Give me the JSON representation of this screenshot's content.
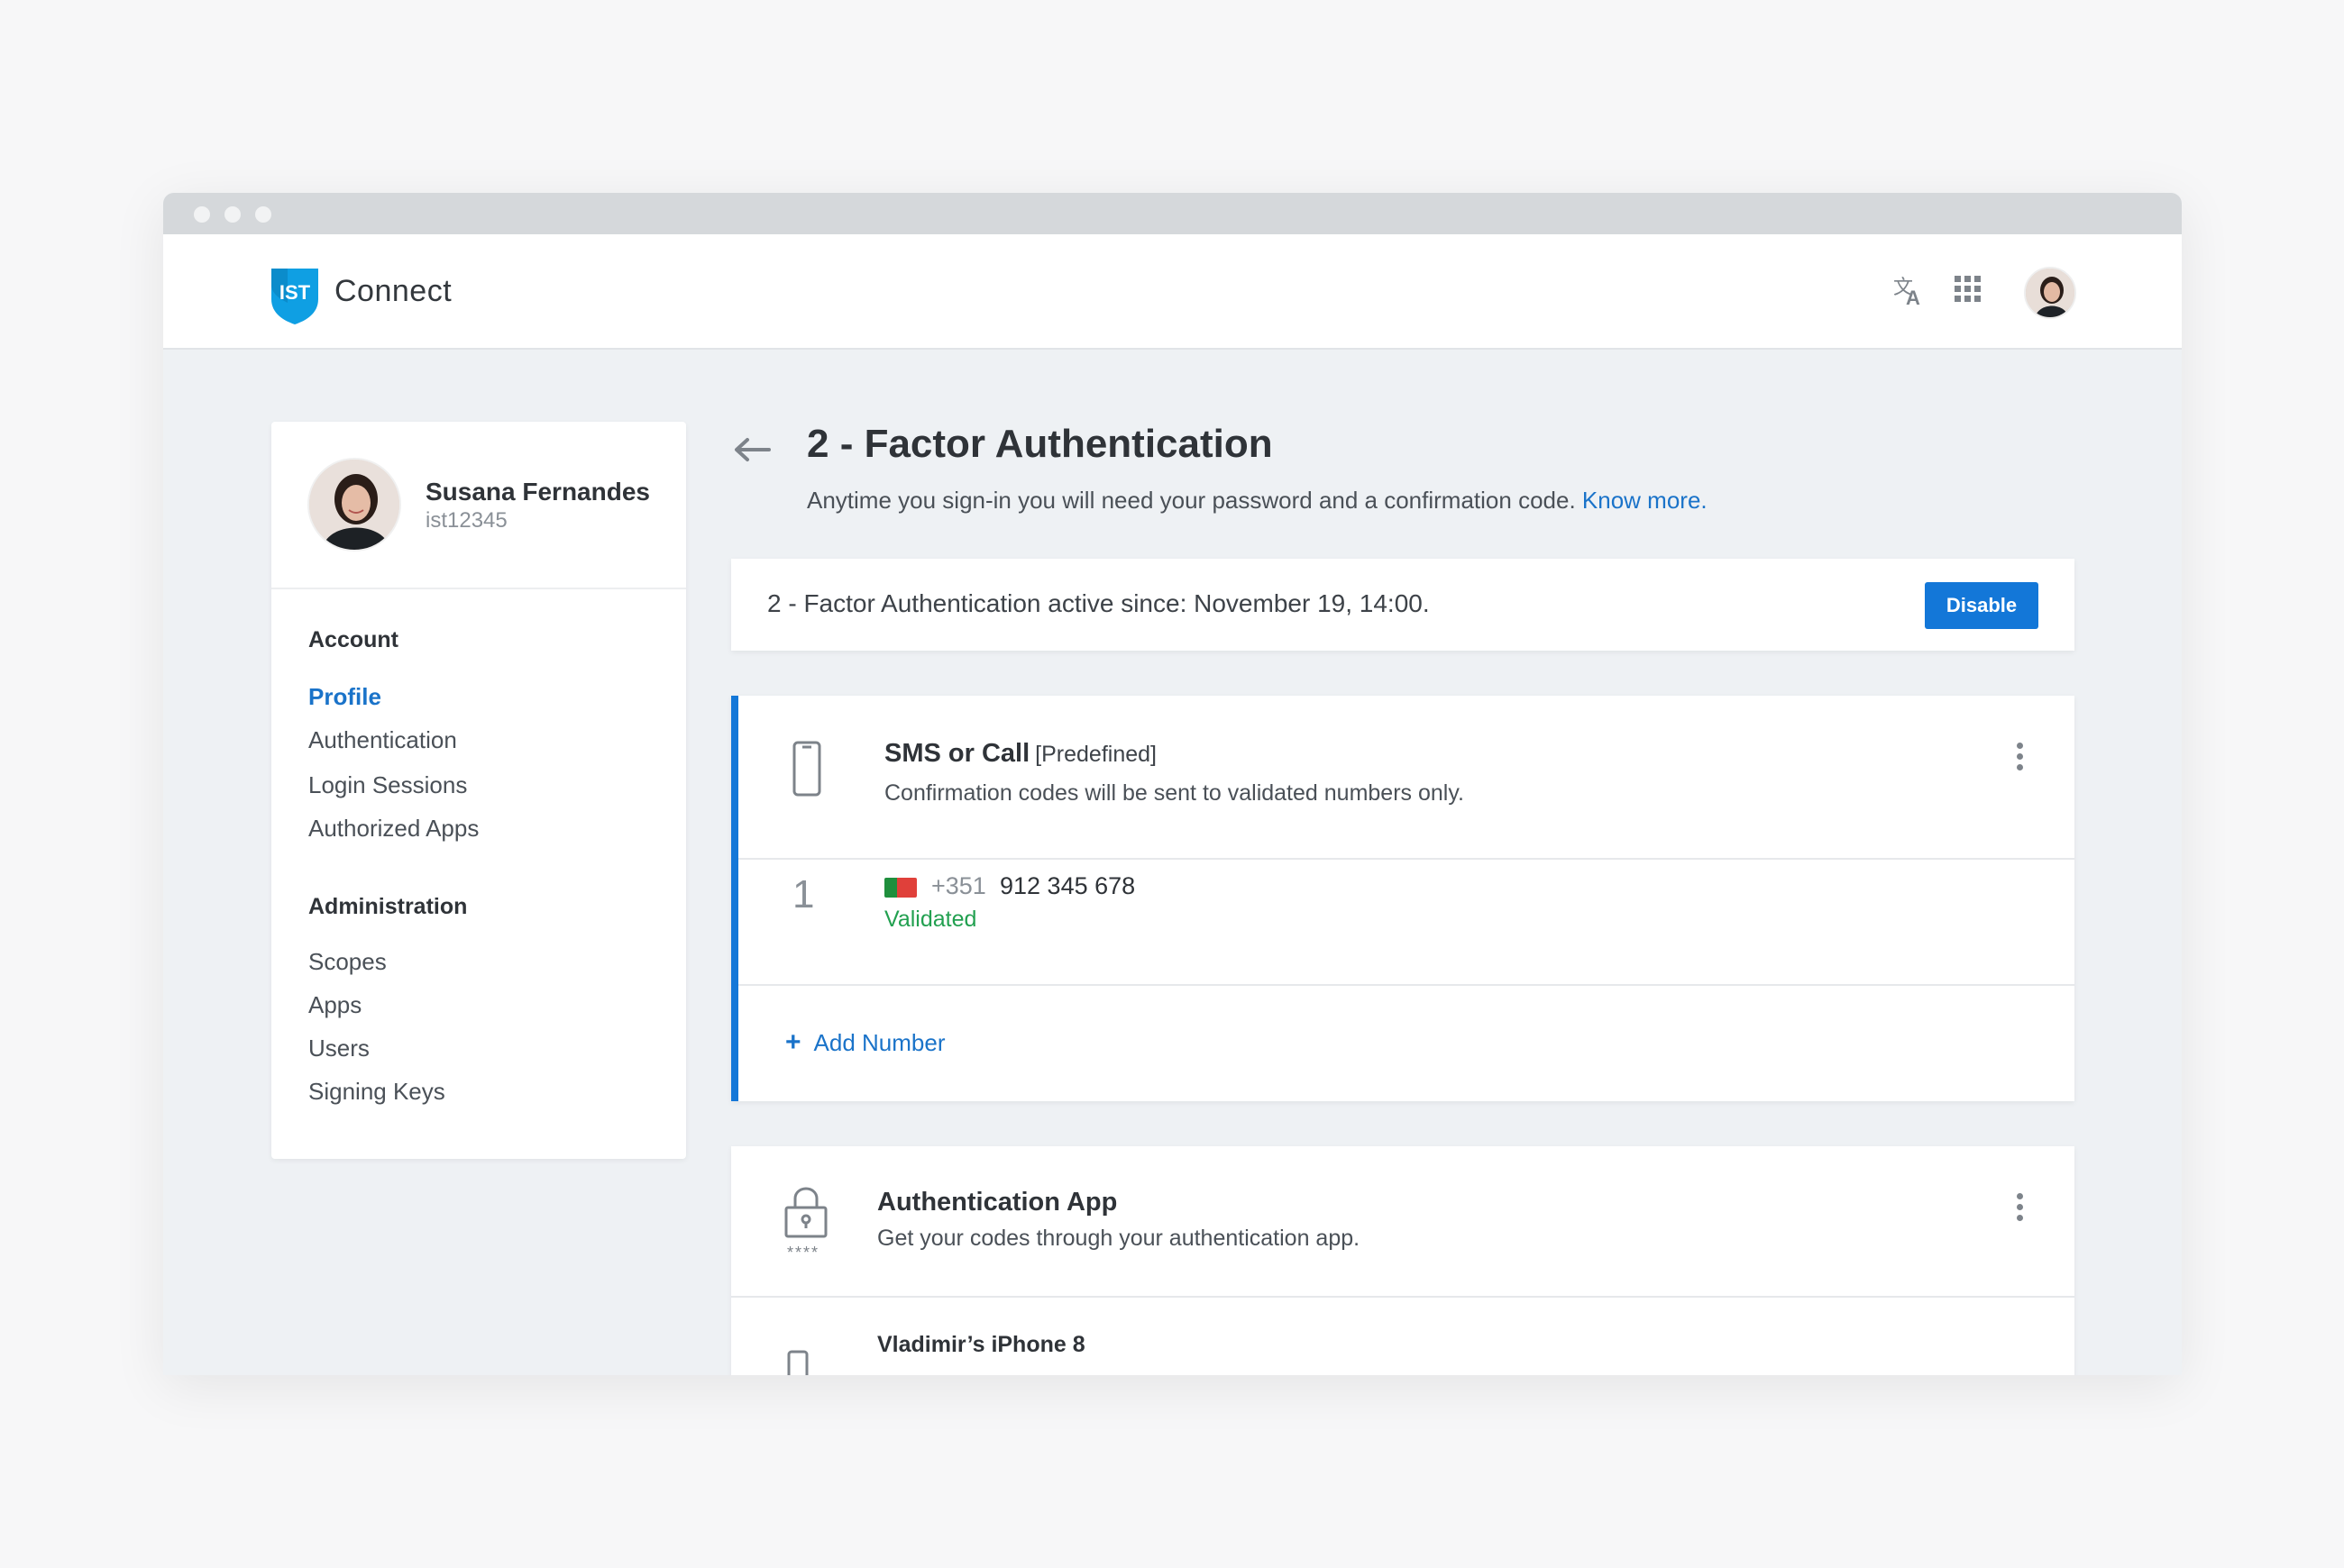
{
  "app": {
    "name": "Connect"
  },
  "header": {
    "translate_icon": "translate-icon",
    "apps_icon": "apps-grid-icon"
  },
  "user": {
    "name": "Susana Fernandes",
    "id": "ist12345"
  },
  "sidebar": {
    "sections": [
      {
        "title": "Account",
        "items": [
          {
            "label": "Profile",
            "active": true
          },
          {
            "label": "Authentication"
          },
          {
            "label": "Login Sessions"
          },
          {
            "label": "Authorized Apps"
          }
        ]
      },
      {
        "title": "Administration",
        "items": [
          {
            "label": "Scopes"
          },
          {
            "label": "Apps"
          },
          {
            "label": "Users"
          },
          {
            "label": "Signing Keys"
          }
        ]
      }
    ]
  },
  "page": {
    "title": "2 - Factor Authentication",
    "subtitle": "Anytime you sign-in you will need your password and a confirmation code.",
    "know_more": "Know more."
  },
  "status": {
    "text": "2 - Factor Authentication active since: November 19, 14:00.",
    "disable_label": "Disable"
  },
  "sms": {
    "title": "SMS or Call",
    "tag": "[Predefined]",
    "description": "Confirmation codes will be sent to validated numbers only.",
    "numbers": [
      {
        "index": "1",
        "country_code": "+351",
        "number": "912 345 678",
        "status": "Validated"
      }
    ],
    "add_label": "Add Number"
  },
  "auth_app": {
    "title": "Authentication App",
    "description": "Get your codes through your authentication app.",
    "stars": "****",
    "devices": [
      {
        "name": "Vladimir’s iPhone 8"
      }
    ]
  },
  "colors": {
    "accent": "#1377d8",
    "validated": "#22a050",
    "background": "#eef1f4"
  }
}
